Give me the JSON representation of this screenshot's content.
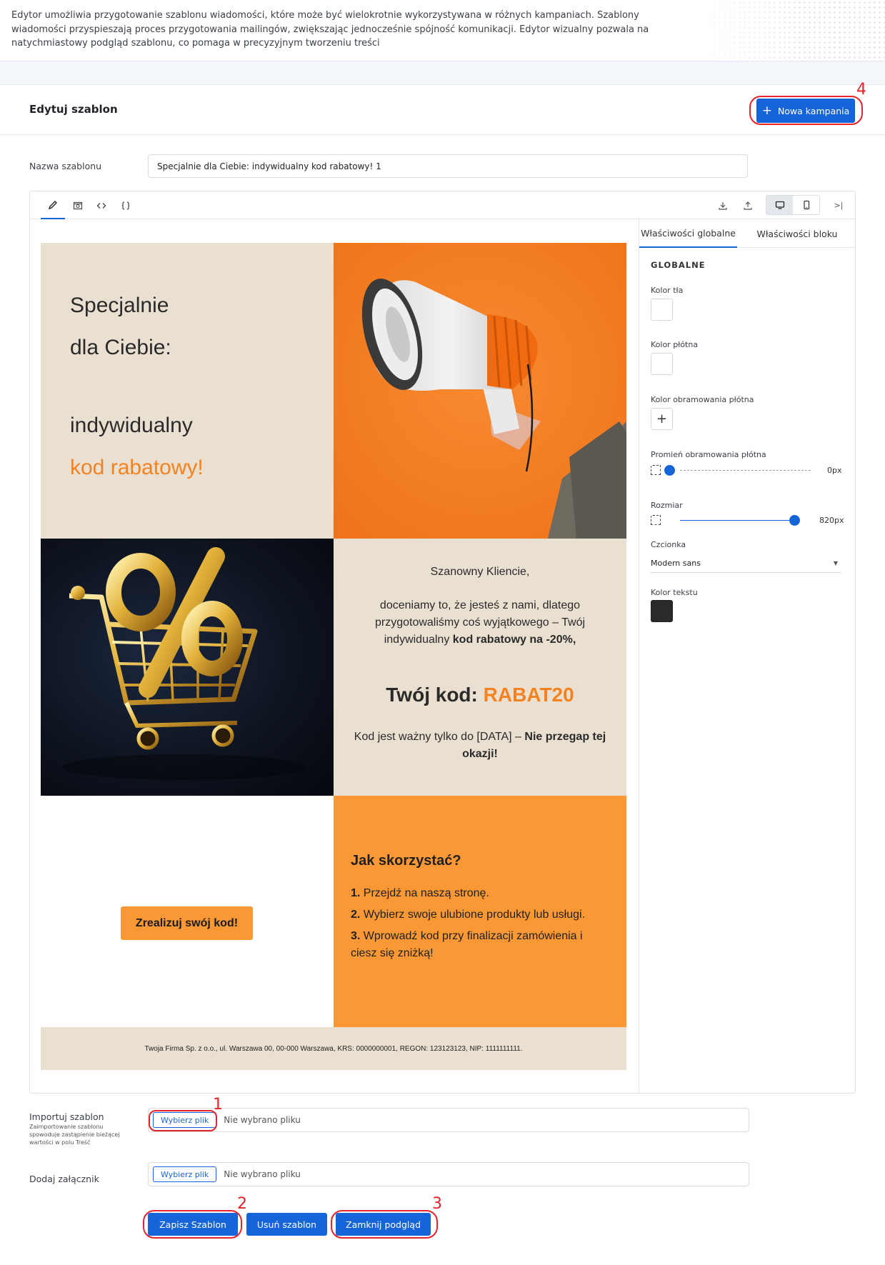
{
  "intro": "Edytor umożliwia przygotowanie szablonu wiadomości, które może być wielokrotnie wykorzystywana w różnych kampaniach. Szablony wiadomości przyspieszają proces przygotowania mailingów, zwiększając jednocześnie spójność komunikacji. Edytor wizualny pozwala na natychmiastowy podgląd szablonu, co pomaga w precyzyjnym tworzeniu treści",
  "header": {
    "title": "Edytuj szablon",
    "new_campaign_label": "Nowa kampania"
  },
  "form": {
    "name_label": "Nazwa szablonu",
    "name_value": "Specjalnie dla Ciebie: indywidualny kod rabatowy! 1",
    "import_label": "Importuj szablon",
    "import_help": "Zaimportowanie szablonu spowoduje zastąpienie bieżącej wartości w polu Treść",
    "attach_label": "Dodaj załącznik",
    "choose_file_label": "Wybierz plik",
    "no_file_text": "Nie wybrano pliku"
  },
  "actions": {
    "save_label": "Zapisz Szablon",
    "delete_label": "Usuń szablon",
    "close_preview_label": "Zamknij podgląd"
  },
  "annotations": [
    "1",
    "2",
    "3",
    "4"
  ],
  "toolbar": {
    "tool_icons": [
      "pencil-icon",
      "preview-icon",
      "code-icon",
      "braces-icon"
    ],
    "right_icons": [
      "download-icon",
      "upload-icon",
      "desktop-icon",
      "mobile-icon",
      "collapse-panel-icon"
    ],
    "collapse_glyph": ">|"
  },
  "email": {
    "hero_line1": "Specjalnie",
    "hero_line2": "dla Ciebie:",
    "hero_line3": "indywidualny",
    "hero_line4": "kod rabatowy!",
    "greeting": "Szanowny Kliencie,",
    "body_start": "doceniamy to, że jesteś z nami, dlatego przygotowaliśmy coś wyjątkowego – Twój indywidualny ",
    "body_bold": "kod rabatowy na -20%,",
    "code_label": "Twój kod: ",
    "code_value": "RABAT20",
    "valid_start": "Kod jest ważny tylko do [DATA] – ",
    "valid_bold": "Nie przegap tej okazji!",
    "cta_label": "Zrealizuj swój kod!",
    "how_title": "Jak skorzystać?",
    "steps": [
      {
        "num": "1.",
        "text": " Przejdź na naszą stronę."
      },
      {
        "num": "2.",
        "text": " Wybierz swoje ulubione produkty lub usługi."
      },
      {
        "num": "3.",
        "text": " Wprowadź kod przy finalizacji zamówienia i ciesz się zniżką!"
      }
    ],
    "footer": "Twoja Firma Sp. z o.o., ul. Warszawa 00, 00-000 Warszawa, KRS: 0000000001, REGON: 123123123, NIP: 1111111111.",
    "accent_color": "#f58220"
  },
  "props": {
    "tab_global": "Właściwości globalne",
    "tab_block": "Właściwości bloku",
    "section": "GLOBALNE",
    "bg_color_label": "Kolor tła",
    "canvas_color_label": "Kolor płótna",
    "canvas_border_color_label": "Kolor obramowania płótna",
    "radius_label": "Promień obramowania płótna",
    "radius_value": "0px",
    "radius_fraction": 0,
    "size_label": "Rozmiar",
    "size_value": "820px",
    "size_fraction": 1,
    "font_label": "Czcionka",
    "font_value": "Modern sans",
    "text_color_label": "Kolor tekstu",
    "text_color": "#2a2a2a"
  }
}
